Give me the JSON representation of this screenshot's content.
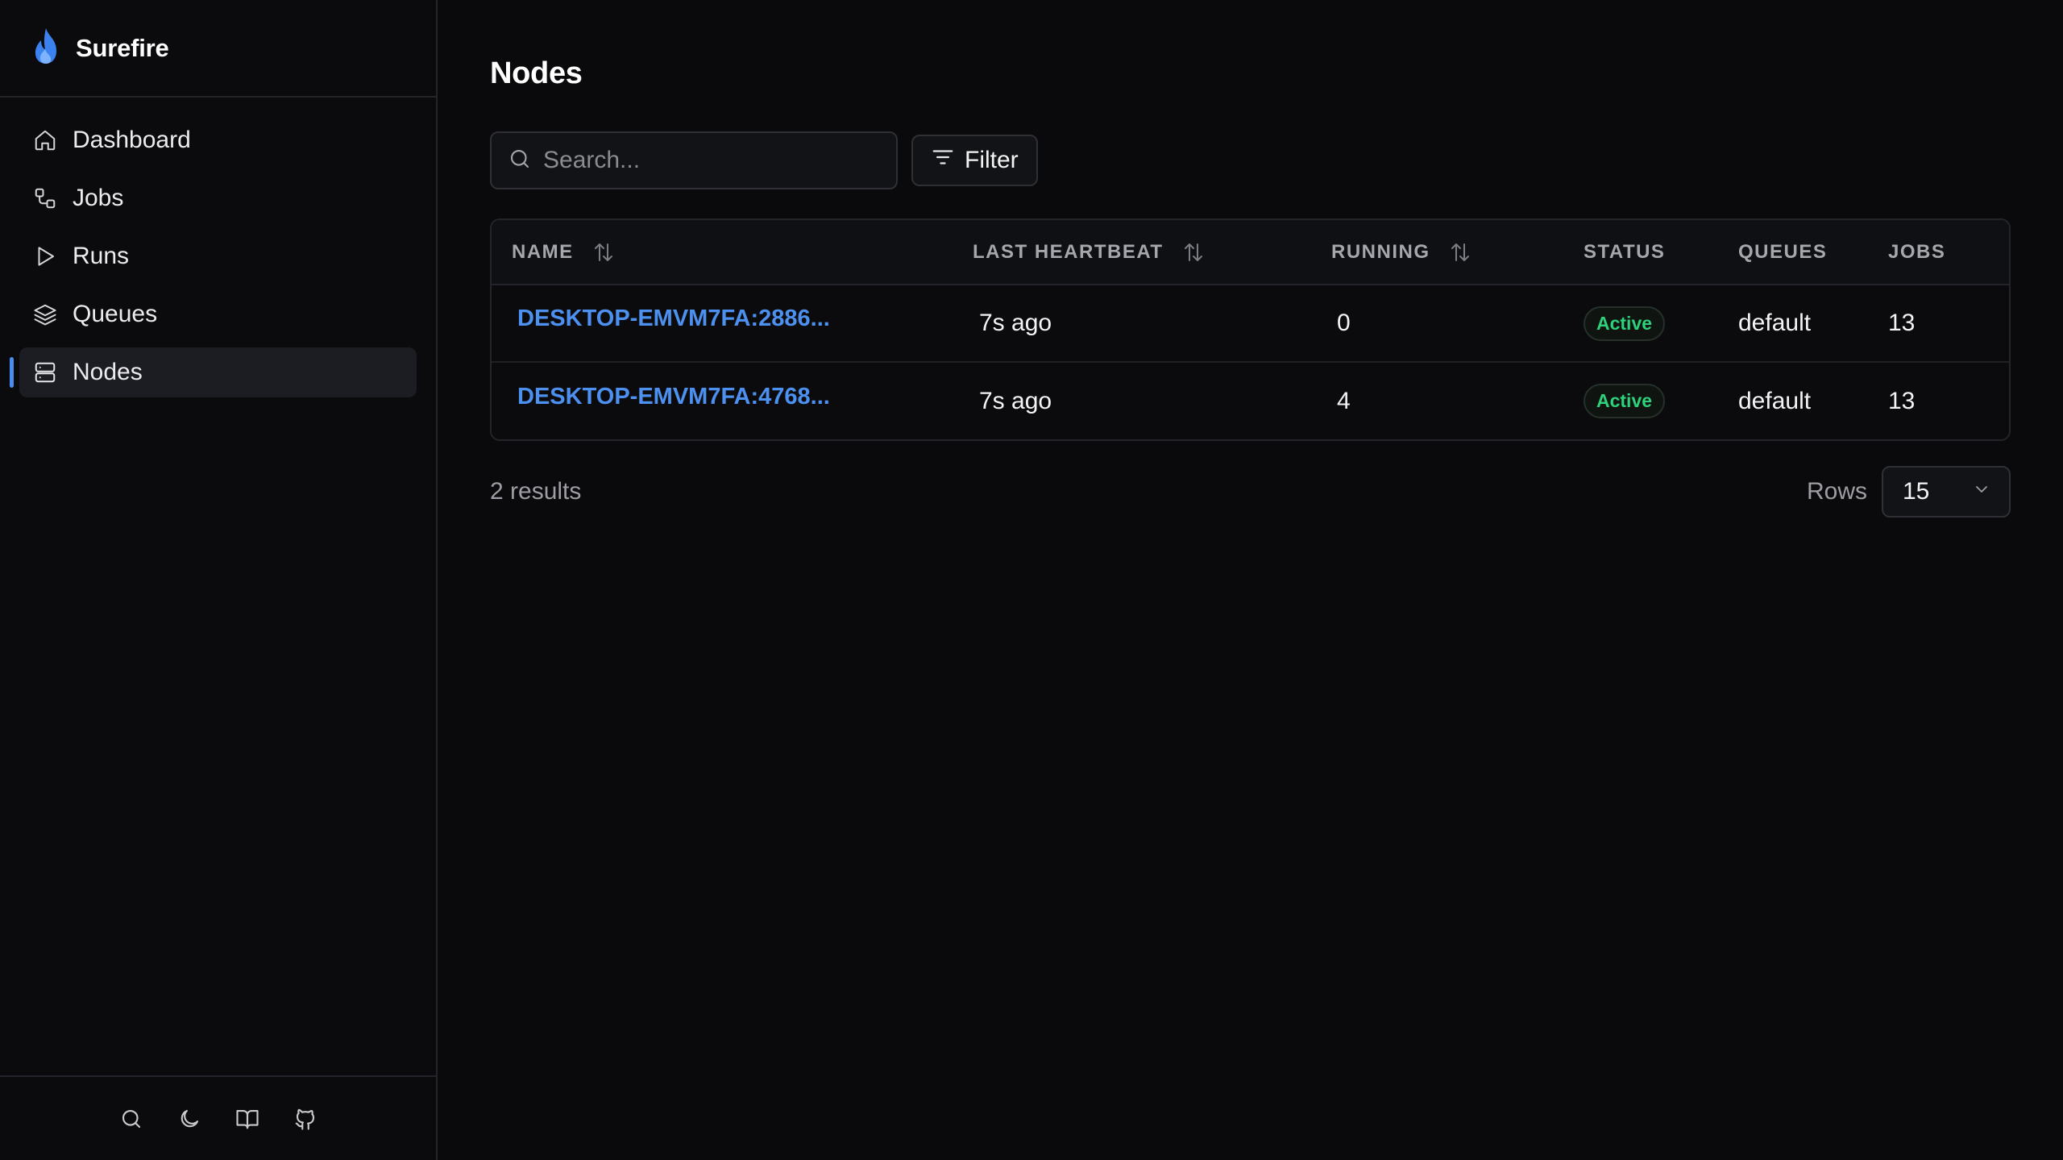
{
  "app": {
    "name": "Surefire"
  },
  "sidebar": {
    "items": [
      {
        "label": "Dashboard",
        "icon": "home-icon",
        "active": false
      },
      {
        "label": "Jobs",
        "icon": "workflow-icon",
        "active": false
      },
      {
        "label": "Runs",
        "icon": "play-icon",
        "active": false
      },
      {
        "label": "Queues",
        "icon": "layers-icon",
        "active": false
      },
      {
        "label": "Nodes",
        "icon": "server-icon",
        "active": true
      }
    ],
    "footer_icons": [
      "search-icon",
      "moon-icon",
      "book-icon",
      "github-icon"
    ]
  },
  "page": {
    "title": "Nodes"
  },
  "toolbar": {
    "search_placeholder": "Search...",
    "filter_label": "Filter"
  },
  "table": {
    "columns": [
      "NAME",
      "LAST HEARTBEAT",
      "RUNNING",
      "STATUS",
      "QUEUES",
      "JOBS"
    ],
    "rows": [
      {
        "name": "DESKTOP-EMVM7FA:2886...",
        "last_heartbeat": "7s ago",
        "running": "0",
        "status": "Active",
        "queues": "default",
        "jobs": "13"
      },
      {
        "name": "DESKTOP-EMVM7FA:4768...",
        "last_heartbeat": "7s ago",
        "running": "4",
        "status": "Active",
        "queues": "default",
        "jobs": "13"
      }
    ]
  },
  "footer": {
    "results": "2 results",
    "rows_label": "Rows",
    "rows_value": "15"
  },
  "colors": {
    "accent": "#4a8df0",
    "link": "#4d91f0",
    "status_active": "#2fd07a",
    "background": "#0a0a0c"
  }
}
